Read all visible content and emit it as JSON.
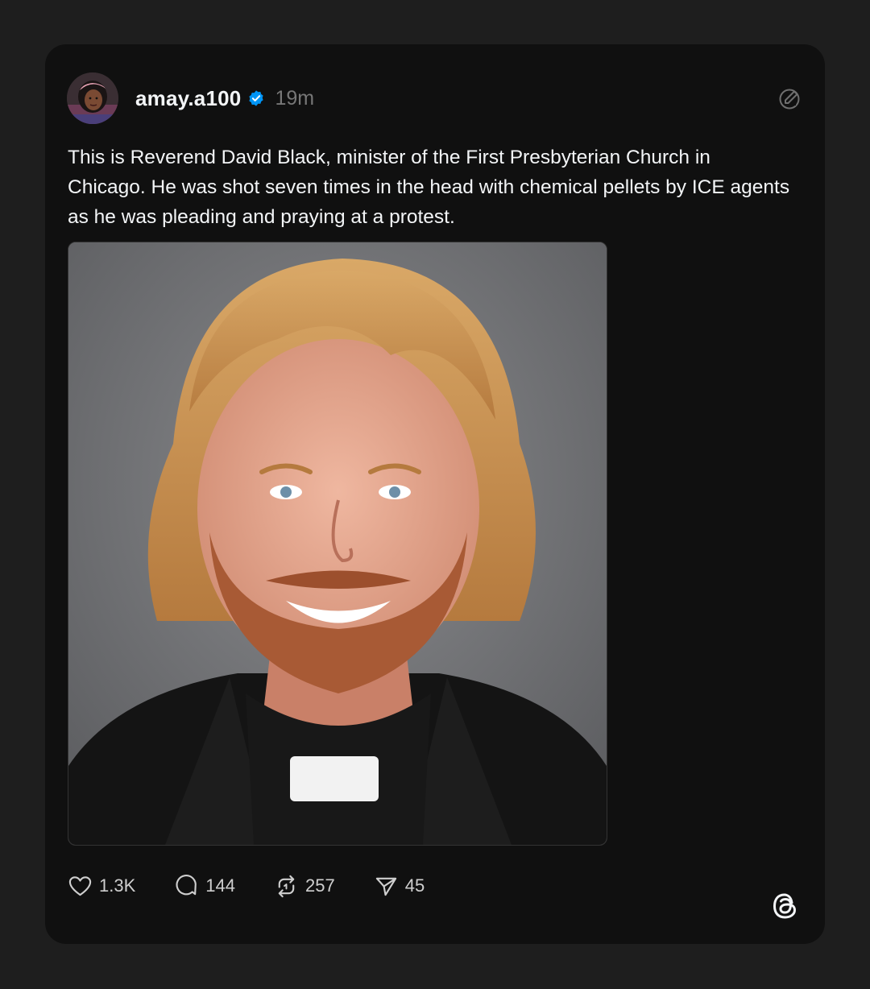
{
  "post": {
    "author": {
      "username": "amay.a100",
      "verified": true,
      "timestamp": "19m",
      "avatar_icon": "avatar-photo"
    },
    "text": "This is Reverend David Black, minister of the First Presbyterian Church in Chicago. He was shot seven times in the head with chemical pellets by ICE agents as he was pleading and praying at a protest.",
    "image": {
      "alt": "Portrait photo of a smiling man with reddish-blond hair and beard wearing a black clerical collar shirt"
    },
    "actions": {
      "likes": "1.3K",
      "replies": "144",
      "reposts": "257",
      "shares": "45"
    }
  },
  "icons": {
    "like": "heart-icon",
    "reply": "speech-bubble-icon",
    "repost": "repost-icon",
    "share": "paper-plane-icon",
    "compose": "compose-icon",
    "brand": "threads-logo-icon",
    "verified": "verified-badge-icon"
  },
  "colors": {
    "background": "#1e1e1e",
    "card": "#101010",
    "text": "#f3f5f7",
    "muted": "#777777",
    "verified": "#0095f6"
  }
}
